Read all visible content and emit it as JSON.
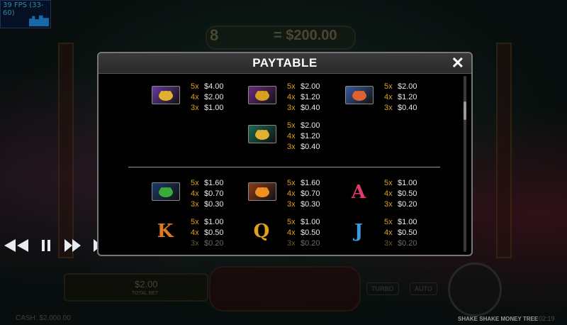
{
  "fps": {
    "label": "39 FPS (33-60)"
  },
  "header": {
    "count": "8",
    "amount": "= $200.00"
  },
  "playback": {
    "rewind_icon": "rewind-icon",
    "pause_icon": "pause-icon",
    "forward_icon": "forward-icon",
    "fast_forward_icon": "fast-forward-icon"
  },
  "bet": {
    "value": "$2.00",
    "label": "TOTAL BET"
  },
  "buttons": {
    "turbo": "TURBO",
    "auto": "AUTO"
  },
  "footer": {
    "cash": "CASH: $2,000.00",
    "game_title": "SHAKE SHAKE MONEY TREE",
    "clock": "02:19"
  },
  "paytable": {
    "title": "PAYTABLE",
    "close_icon": "close-icon",
    "premium": [
      {
        "name": "Golden Dragon",
        "icon": "dragon-icon",
        "colors": {
          "tile": "#6a3aa0",
          "art": "#e0b030"
        },
        "rows": [
          {
            "k": "5x",
            "v": "$4.00"
          },
          {
            "k": "4x",
            "v": "$2.00"
          },
          {
            "k": "3x",
            "v": "$1.00"
          }
        ]
      },
      {
        "name": "Money Toad",
        "icon": "toad-icon",
        "colors": {
          "tile": "#6a2a80",
          "art": "#d8a020"
        },
        "rows": [
          {
            "k": "5x",
            "v": "$2.00"
          },
          {
            "k": "4x",
            "v": "$1.20"
          },
          {
            "k": "3x",
            "v": "$0.40"
          }
        ]
      },
      {
        "name": "Phoenix",
        "icon": "phoenix-icon",
        "colors": {
          "tile": "#3a5aa0",
          "art": "#e06030"
        },
        "rows": [
          {
            "k": "5x",
            "v": "$2.00"
          },
          {
            "k": "4x",
            "v": "$1.20"
          },
          {
            "k": "3x",
            "v": "$0.40"
          }
        ]
      },
      {
        "name": "Koi Fish",
        "icon": "koi-icon",
        "colors": {
          "tile": "#1a6a50",
          "art": "#e0b030"
        },
        "rows": [
          {
            "k": "5x",
            "v": "$2.00"
          },
          {
            "k": "4x",
            "v": "$1.20"
          },
          {
            "k": "3x",
            "v": "$0.40"
          }
        ]
      }
    ],
    "low": [
      {
        "name": "Bonsai",
        "icon": "bonsai-icon",
        "colors": {
          "tile": "#1a3a6a",
          "art": "#3aaa3a"
        },
        "rows": [
          {
            "k": "5x",
            "v": "$1.60"
          },
          {
            "k": "4x",
            "v": "$0.70"
          },
          {
            "k": "3x",
            "v": "$0.30"
          }
        ]
      },
      {
        "name": "Oranges",
        "icon": "oranges-icon",
        "colors": {
          "tile": "#8a3a1a",
          "art": "#f09020"
        },
        "rows": [
          {
            "k": "5x",
            "v": "$1.60"
          },
          {
            "k": "4x",
            "v": "$0.70"
          },
          {
            "k": "3x",
            "v": "$0.30"
          }
        ]
      },
      {
        "name": "A",
        "icon": "letter-a-icon",
        "letter": "A",
        "colors": {
          "art": "#e03a6a"
        },
        "rows": [
          {
            "k": "5x",
            "v": "$1.00"
          },
          {
            "k": "4x",
            "v": "$0.50"
          },
          {
            "k": "3x",
            "v": "$0.20"
          }
        ]
      },
      {
        "name": "K",
        "icon": "letter-k-icon",
        "letter": "K",
        "colors": {
          "art": "#e07a20"
        },
        "rows": [
          {
            "k": "5x",
            "v": "$1.00"
          },
          {
            "k": "4x",
            "v": "$0.50"
          },
          {
            "k": "3x",
            "v": "$0.20"
          }
        ]
      },
      {
        "name": "Q",
        "icon": "letter-q-icon",
        "letter": "Q",
        "colors": {
          "art": "#e0a020"
        },
        "rows": [
          {
            "k": "5x",
            "v": "$1.00"
          },
          {
            "k": "4x",
            "v": "$0.50"
          },
          {
            "k": "3x",
            "v": "$0.20"
          }
        ]
      },
      {
        "name": "J",
        "icon": "letter-j-icon",
        "letter": "J",
        "colors": {
          "art": "#3a9ae0"
        },
        "rows": [
          {
            "k": "5x",
            "v": "$1.00"
          },
          {
            "k": "4x",
            "v": "$0.50"
          },
          {
            "k": "3x",
            "v": "$0.20"
          }
        ]
      }
    ]
  }
}
